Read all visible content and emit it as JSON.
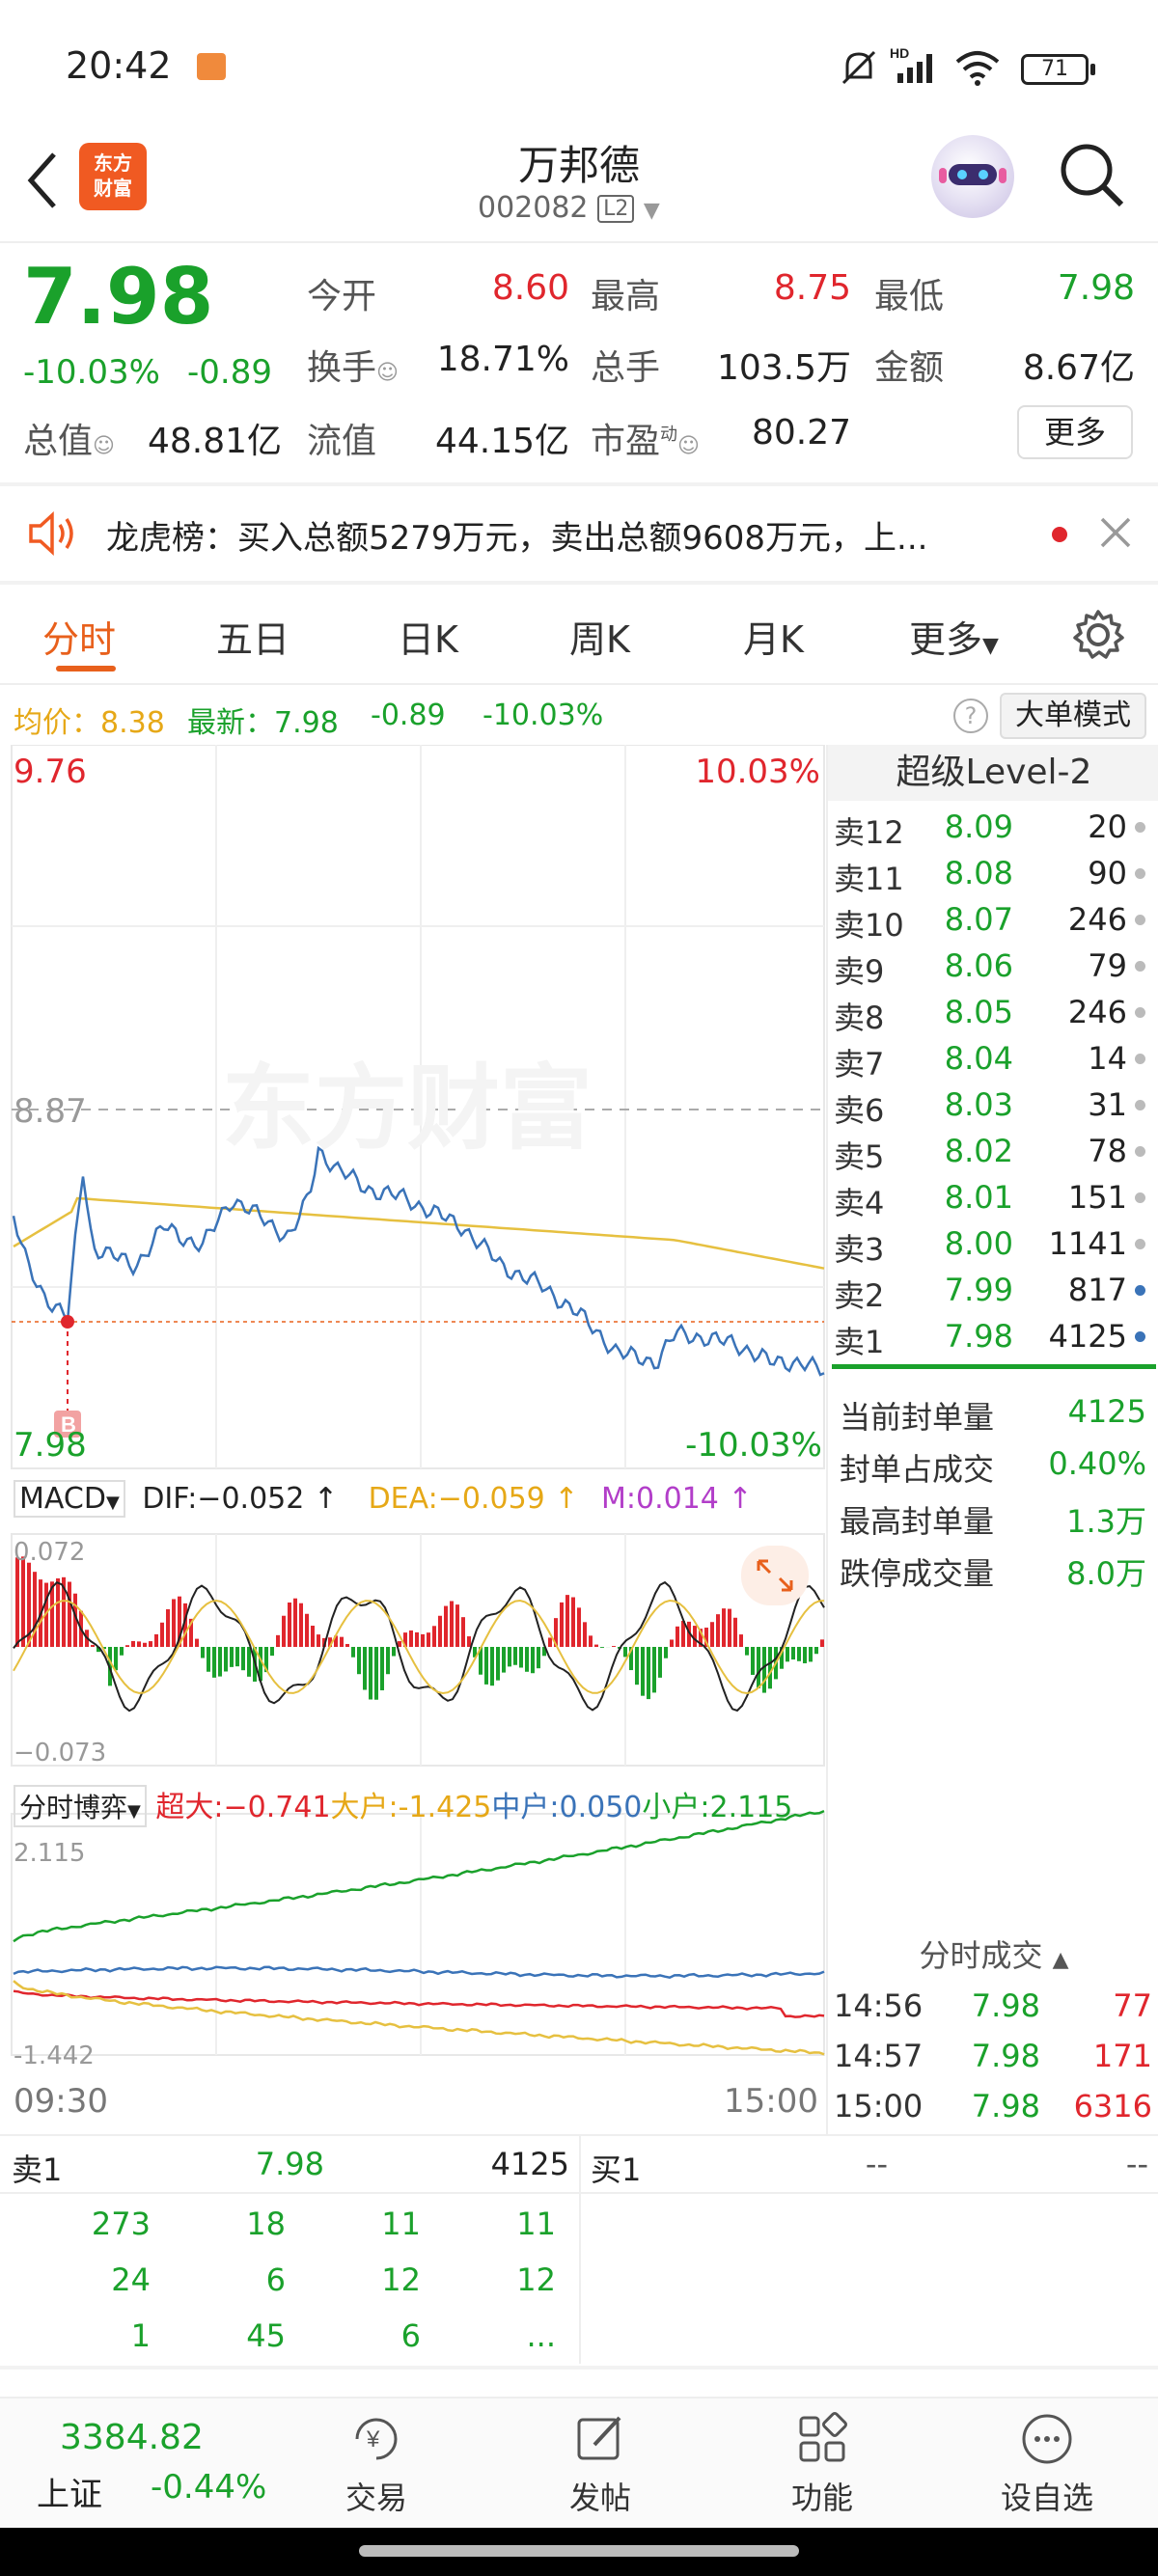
{
  "status_bar": {
    "time": "20:42",
    "battery": "71",
    "network": "HD"
  },
  "header": {
    "logo_line1": "东方",
    "logo_line2": "财富",
    "name": "万邦德",
    "code": "002082",
    "badge": "L2"
  },
  "quote": {
    "price": "7.98",
    "change_pct": "-10.03%",
    "change": "-0.89",
    "open_label": "今开",
    "open": "8.60",
    "high_label": "最高",
    "high": "8.75",
    "low_label": "最低",
    "low": "7.98",
    "turnover_label": "换手",
    "turnover": "18.71%",
    "volume_label": "总手",
    "volume": "103.5万",
    "amount_label": "金额",
    "amount": "8.67亿",
    "mktcap_label": "总值",
    "mktcap": "48.81亿",
    "float_label": "流值",
    "float": "44.15亿",
    "pe_label": "市盈",
    "pe_sup": "动",
    "pe": "80.27",
    "more": "更多"
  },
  "notice": {
    "text": "龙虎榜：买入总额5279万元，卖出总额9608万元，上..."
  },
  "tabs": [
    "分时",
    "五日",
    "日K",
    "周K",
    "月K",
    "更多"
  ],
  "info_line": {
    "avg_label": "均价：",
    "avg": "8.38",
    "latest_label": "最新：",
    "latest": "7.98",
    "chg": "-0.89",
    "pct": "-10.03%",
    "mode_btn": "大单模式"
  },
  "chart_labels": {
    "top_price": "9.76",
    "top_pct": "10.03%",
    "mid_price": "8.87",
    "bottom_price": "7.98",
    "bottom_pct": "-10.03%",
    "watermark": "东方财富",
    "marker": "B"
  },
  "macd": {
    "name": "MACD",
    "dif": "DIF:−0.052",
    "dea": "DEA:−0.059",
    "m": "M:0.014",
    "top": "0.072",
    "bottom": "−0.073"
  },
  "flow": {
    "name": "分时博弈",
    "super": "超大:−0.741",
    "large": "大户:-1.425",
    "mid": "中户:0.050",
    "small": "小户:2.115",
    "top": "2.115",
    "bottom": "-1.442",
    "time_start": "09:30",
    "time_end": "15:00"
  },
  "level2": {
    "title": "超级Level-2",
    "asks": [
      {
        "label": "卖12",
        "price": "8.09",
        "vol": "20"
      },
      {
        "label": "卖11",
        "price": "8.08",
        "vol": "90"
      },
      {
        "label": "卖10",
        "price": "8.07",
        "vol": "246"
      },
      {
        "label": "卖9",
        "price": "8.06",
        "vol": "79"
      },
      {
        "label": "卖8",
        "price": "8.05",
        "vol": "246"
      },
      {
        "label": "卖7",
        "price": "8.04",
        "vol": "14"
      },
      {
        "label": "卖6",
        "price": "8.03",
        "vol": "31"
      },
      {
        "label": "卖5",
        "price": "8.02",
        "vol": "78"
      },
      {
        "label": "卖4",
        "price": "8.01",
        "vol": "151"
      },
      {
        "label": "卖3",
        "price": "8.00",
        "vol": "1141"
      },
      {
        "label": "卖2",
        "price": "7.99",
        "vol": "817"
      },
      {
        "label": "卖1",
        "price": "7.98",
        "vol": "4125"
      }
    ],
    "seal": [
      {
        "label": "当前封单量",
        "value": "4125"
      },
      {
        "label": "封单占成交",
        "value": "0.40%"
      },
      {
        "label": "最高封单量",
        "value": "1.3万"
      },
      {
        "label": "跌停成交量",
        "value": "8.0万"
      }
    ],
    "ticks_title": "分时成交",
    "ticks": [
      {
        "time": "14:56",
        "price": "7.98",
        "vol": "77"
      },
      {
        "time": "14:57",
        "price": "7.98",
        "vol": "171"
      },
      {
        "time": "15:00",
        "price": "7.98",
        "vol": "6316"
      }
    ]
  },
  "queue": {
    "sell_label": "卖1",
    "sell_price": "7.98",
    "sell_vol": "4125",
    "buy_label": "买1",
    "buy_price": "--",
    "buy_vol": "--",
    "rows": [
      [
        "273",
        "18",
        "11",
        "11"
      ],
      [
        "24",
        "6",
        "12",
        "12"
      ],
      [
        "1",
        "45",
        "6",
        "..."
      ]
    ]
  },
  "bottom_nav": {
    "index_value": "3384.82",
    "index_name": "上证",
    "index_chg": "-0.44%",
    "items": [
      "交易",
      "发帖",
      "功能",
      "设自选"
    ]
  },
  "colors": {
    "up": "#e0262d",
    "down": "#1aa12b",
    "avg": "#e6a817",
    "price_line": "#3a73b8",
    "tab_active": "#e8601c"
  }
}
